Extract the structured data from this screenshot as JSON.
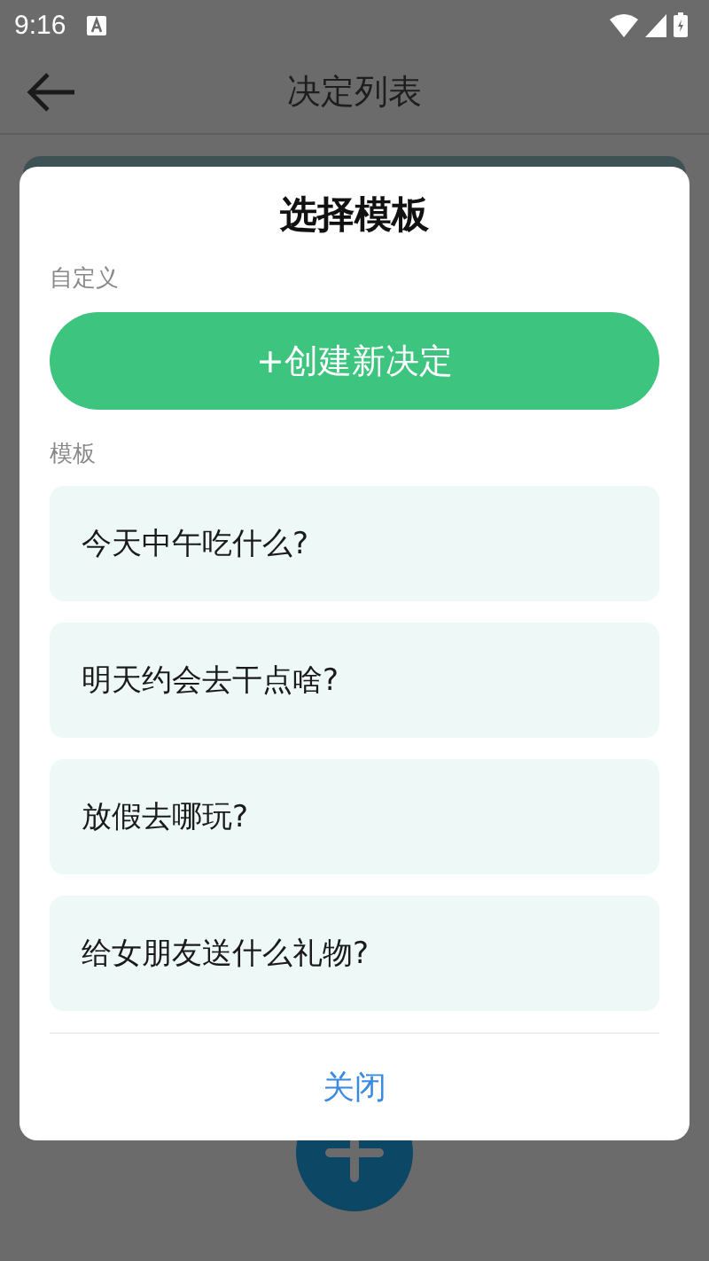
{
  "status_bar": {
    "time": "9:16"
  },
  "app_bar": {
    "title": "决定列表"
  },
  "dialog": {
    "title": "选择模板",
    "custom_label": "自定义",
    "create_button": "+创建新决定",
    "templates_label": "模板",
    "templates": [
      {
        "label": "今天中午吃什么?"
      },
      {
        "label": "明天约会去干点啥?"
      },
      {
        "label": "放假去哪玩?"
      },
      {
        "label": "给女朋友送什么礼物?"
      }
    ],
    "close_button": "关闭"
  }
}
